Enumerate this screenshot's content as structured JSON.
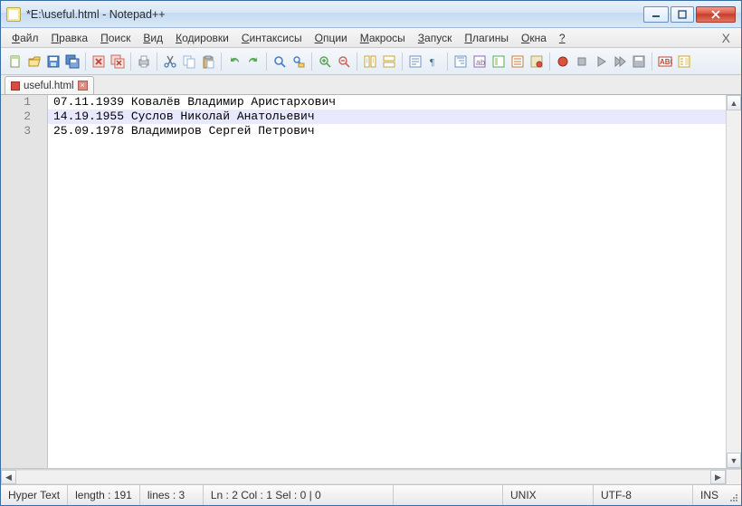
{
  "window": {
    "title": "*E:\\useful.html - Notepad++"
  },
  "menu": {
    "items": [
      {
        "hot": "Ф",
        "rest": "айл"
      },
      {
        "hot": "П",
        "rest": "равка"
      },
      {
        "hot": "П",
        "rest": "оиск"
      },
      {
        "hot": "В",
        "rest": "ид"
      },
      {
        "hot": "К",
        "rest": "одировки"
      },
      {
        "hot": "С",
        "rest": "интаксисы"
      },
      {
        "hot": "О",
        "rest": "пции"
      },
      {
        "hot": "М",
        "rest": "акросы"
      },
      {
        "hot": "З",
        "rest": "апуск"
      },
      {
        "hot": "П",
        "rest": "лагины"
      },
      {
        "hot": "О",
        "rest": "кна"
      },
      {
        "hot": "?",
        "rest": ""
      }
    ]
  },
  "toolbar": {
    "icons": [
      "new-icon",
      "open-icon",
      "save-icon",
      "save-all-icon",
      "sep",
      "close-icon",
      "close-all-icon",
      "sep",
      "print-icon",
      "sep",
      "cut-icon",
      "copy-icon",
      "paste-icon",
      "sep",
      "undo-icon",
      "redo-icon",
      "sep",
      "find-icon",
      "replace-icon",
      "sep",
      "zoom-in-icon",
      "zoom-out-icon",
      "sep",
      "sync-v-icon",
      "sync-h-icon",
      "sep",
      "wrap-icon",
      "all-chars-icon",
      "sep",
      "indent-guide-icon",
      "lang-icon",
      "doc-map-icon",
      "func-list-icon",
      "folder-icon",
      "sep",
      "record-icon",
      "stop-icon",
      "play-icon",
      "play-multi-icon",
      "save-macro-icon",
      "sep",
      "spell-icon",
      "doc-list-icon"
    ]
  },
  "tab": {
    "name": "useful.html"
  },
  "editor": {
    "lines": [
      {
        "num": "1",
        "text": "07.11.1939 Ковалёв Владимир Аристархович",
        "current": false
      },
      {
        "num": "2",
        "text": "14.19.1955 Суслов Николай Анатольевич",
        "current": true
      },
      {
        "num": "3",
        "text": "25.09.1978 Владимиров Сергей Петрович",
        "current": false
      }
    ]
  },
  "status": {
    "lang": "Hyper Text",
    "length": "length : 191",
    "lines": "lines : 3",
    "pos": "Ln : 2    Col : 1    Sel : 0 | 0",
    "eol": "UNIX",
    "enc": "UTF-8",
    "ovr": "INS"
  }
}
